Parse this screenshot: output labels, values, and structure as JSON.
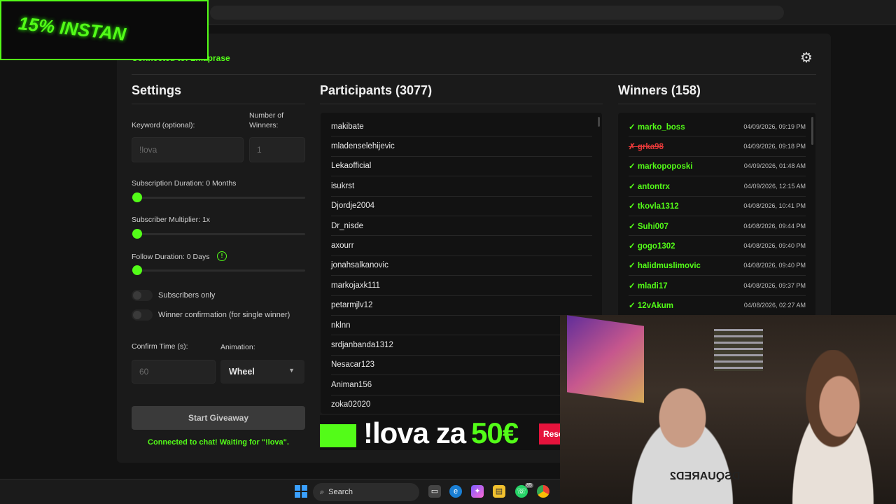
{
  "overlay": {
    "promo_text": "15% INSTAN"
  },
  "header": {
    "connection_status": "Connected to: Lmaprase"
  },
  "settings": {
    "title": "Settings",
    "keyword_label": "Keyword (optional):",
    "keyword_placeholder": "!lova",
    "winners_count_label": "Number of Winners:",
    "winners_count_placeholder": "1",
    "sub_duration_label": "Subscription Duration: 0 Months",
    "sub_duration_value": 0,
    "multiplier_label": "Subscriber Multiplier: 1x",
    "multiplier_value": 1,
    "follow_label": "Follow Duration:  0  Days",
    "follow_value": 0,
    "info_icon_glyph": "!",
    "subs_only_label": "Subscribers only",
    "subs_only_on": false,
    "winner_confirm_label": "Winner confirmation (for single winner)",
    "winner_confirm_on": false,
    "confirm_time_label": "Confirm Time (s):",
    "confirm_time_placeholder": "60",
    "animation_label": "Animation:",
    "animation_value": "Wheel",
    "start_button": "Start Giveaway",
    "status_message": "Connected to chat! Waiting for \"!lova\"."
  },
  "participants": {
    "title": "Participants (3077)",
    "items": [
      "makibate",
      "mladenselehijevic",
      "Lekaofficial",
      "isukrst",
      "Djordje2004",
      "Dr_nisde",
      "axourr",
      "jonahsalkanovic",
      "markojaxk111",
      "petarmjlv12",
      "nklnn",
      "srdjanbanda1312",
      "Nesacar123",
      "Animan156",
      "zoka02020"
    ]
  },
  "winners": {
    "title": "Winners (158)",
    "items": [
      {
        "mark": "✓",
        "name": "marko_boss",
        "date": "04/09/2026, 09:19 PM",
        "rejected": false
      },
      {
        "mark": "✗",
        "name": "grka98",
        "date": "04/09/2026, 09:18 PM",
        "rejected": true
      },
      {
        "mark": "✓",
        "name": "markopoposki",
        "date": "04/09/2026, 01:48 AM",
        "rejected": false
      },
      {
        "mark": "✓",
        "name": "antontrx",
        "date": "04/09/2026, 12:15 AM",
        "rejected": false
      },
      {
        "mark": "✓",
        "name": "tkovla1312",
        "date": "04/08/2026, 10:41 PM",
        "rejected": false
      },
      {
        "mark": "✓",
        "name": "Suhi007",
        "date": "04/08/2026, 09:44 PM",
        "rejected": false
      },
      {
        "mark": "✓",
        "name": "gogo1302",
        "date": "04/08/2026, 09:40 PM",
        "rejected": false
      },
      {
        "mark": "✓",
        "name": "halidmuslimovic",
        "date": "04/08/2026, 09:40 PM",
        "rejected": false
      },
      {
        "mark": "✓",
        "name": "mladi17",
        "date": "04/08/2026, 09:37 PM",
        "rejected": false
      },
      {
        "mark": "✓",
        "name": "12vAkum",
        "date": "04/08/2026, 02:27 AM",
        "rejected": false
      }
    ]
  },
  "banner": {
    "text_white": "!lova za",
    "text_green": "50€",
    "reset_label": "Rese"
  },
  "webcam": {
    "shirt_text": "DSQUARED2"
  },
  "taskbar": {
    "search_label": "Search",
    "badge": "85"
  },
  "colors": {
    "accent": "#53fc18",
    "danger": "#e83a3a",
    "panel": "#1a1a1a"
  }
}
